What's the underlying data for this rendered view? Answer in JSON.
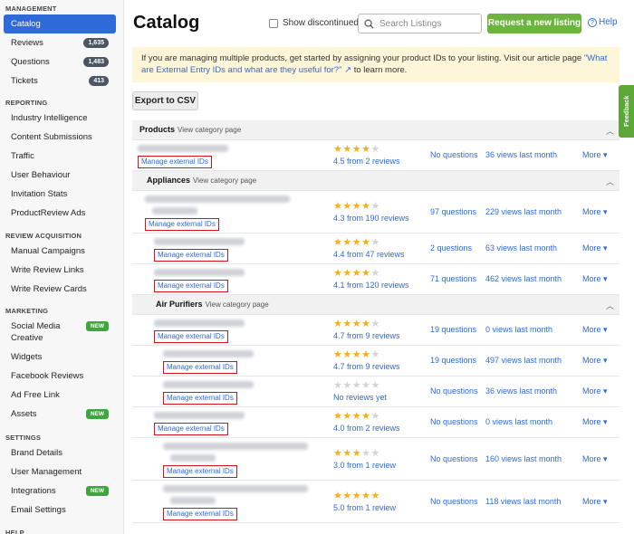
{
  "sidebar": {
    "sections": [
      {
        "title": "MANAGEMENT",
        "items": [
          {
            "label": "Catalog",
            "active": true
          },
          {
            "label": "Reviews",
            "badge": "1,635"
          },
          {
            "label": "Questions",
            "badge": "1,483"
          },
          {
            "label": "Tickets",
            "badge": "413"
          }
        ]
      },
      {
        "title": "REPORTING",
        "items": [
          {
            "label": "Industry Intelligence"
          },
          {
            "label": "Content Submissions"
          },
          {
            "label": "Traffic"
          },
          {
            "label": "User Behaviour"
          },
          {
            "label": "Invitation Stats"
          },
          {
            "label": "ProductReview Ads"
          }
        ]
      },
      {
        "title": "REVIEW ACQUISITION",
        "items": [
          {
            "label": "Manual Campaigns"
          },
          {
            "label": "Write Review Links"
          },
          {
            "label": "Write Review Cards"
          }
        ]
      },
      {
        "title": "MARKETING",
        "items": [
          {
            "label": "Social Media Creative",
            "new": "NEW",
            "twoLine": true
          },
          {
            "label": "Widgets"
          },
          {
            "label": "Facebook Reviews"
          },
          {
            "label": "Ad Free Link"
          },
          {
            "label": "Assets",
            "new": "NEW"
          }
        ]
      },
      {
        "title": "SETTINGS",
        "items": [
          {
            "label": "Brand Details"
          },
          {
            "label": "User Management"
          },
          {
            "label": "Integrations",
            "new": "NEW"
          },
          {
            "label": "Email Settings"
          }
        ]
      },
      {
        "title": "HELP",
        "items": []
      }
    ]
  },
  "header": {
    "title": "Catalog",
    "show_discontinued": "Show discontinued",
    "search_placeholder": "Search Listings",
    "request_button": "Request a new listing",
    "help": "Help"
  },
  "info": {
    "text": "If you are managing multiple products, get started by assigning your product IDs to your listing. Visit our article page ",
    "link": "\"What are External Entry IDs and what are they useful for?\" ↗",
    "suffix": " to learn more."
  },
  "export_button": "Export to CSV",
  "feedback_tab": "Feedback",
  "colors": {
    "accent": "#2f6ad9",
    "green": "#6cb33f",
    "star": "#f2b01e",
    "highlight": "#d4141c"
  },
  "catalog": [
    {
      "kind": "header",
      "name": "Products",
      "sub": "View category page",
      "indent": 0
    },
    {
      "kind": "item",
      "indent": 0,
      "stars": 4.5,
      "rating": "4.5 from 2 reviews",
      "questions": "No questions",
      "views": "36 views last month",
      "more": "More",
      "manage": "Manage external IDs"
    },
    {
      "kind": "header",
      "name": "Appliances",
      "sub": "View category page",
      "indent": 1
    },
    {
      "kind": "item",
      "indent": 1,
      "stars": 4.3,
      "rating": "4.3 from 190 reviews",
      "questions": "97 questions",
      "views": "229 views last month",
      "more": "More",
      "manage": "Manage external IDs",
      "tall": true
    },
    {
      "kind": "item",
      "indent": 2,
      "stars": 4.4,
      "rating": "4.4 from 47 reviews",
      "questions": "2 questions",
      "views": "63 views last month",
      "more": "More",
      "manage": "Manage external IDs"
    },
    {
      "kind": "item",
      "indent": 2,
      "stars": 4.1,
      "rating": "4.1 from 120 reviews",
      "questions": "71 questions",
      "views": "462 views last month",
      "more": "More",
      "manage": "Manage external IDs"
    },
    {
      "kind": "header",
      "name": "Air Purifiers",
      "sub": "View category page",
      "indent": 2
    },
    {
      "kind": "item",
      "indent": 2,
      "stars": 4.7,
      "rating": "4.7 from 9 reviews",
      "questions": "19 questions",
      "views": "0 views last month",
      "more": "More",
      "manage": "Manage external IDs"
    },
    {
      "kind": "item",
      "indent": 3,
      "stars": 4.7,
      "rating": "4.7 from 9 reviews",
      "questions": "19 questions",
      "views": "497 views last month",
      "more": "More",
      "manage": "Manage external IDs"
    },
    {
      "kind": "item",
      "indent": 3,
      "stars": 0,
      "rating": "No reviews yet",
      "questions": "No questions",
      "views": "36 views last month",
      "more": "More",
      "manage": "Manage external IDs"
    },
    {
      "kind": "item",
      "indent": 2,
      "stars": 4.0,
      "rating": "4.0 from 2 reviews",
      "questions": "No questions",
      "views": "0 views last month",
      "more": "More",
      "manage": "Manage external IDs"
    },
    {
      "kind": "item",
      "indent": 3,
      "stars": 3.0,
      "rating": "3.0 from 1 review",
      "questions": "No questions",
      "views": "160 views last month",
      "more": "More",
      "manage": "Manage external IDs",
      "tall": true
    },
    {
      "kind": "item",
      "indent": 3,
      "stars": 5.0,
      "rating": "5.0 from 1 review",
      "questions": "No questions",
      "views": "118 views last month",
      "more": "More",
      "manage": "Manage external IDs",
      "tall": true
    }
  ]
}
